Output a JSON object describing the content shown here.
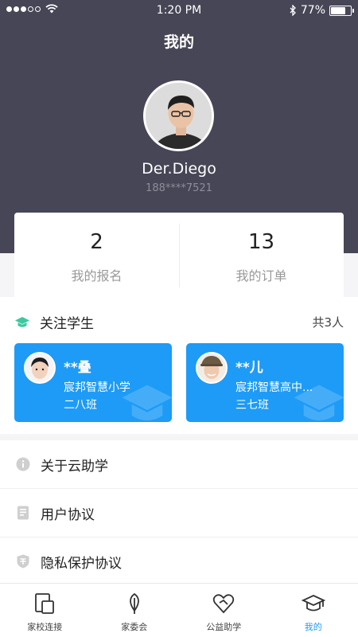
{
  "status_bar": {
    "time": "1:20 PM",
    "battery": "77%",
    "battery_level": 0.77,
    "signal_bars": 3
  },
  "header": {
    "title": "我的"
  },
  "profile": {
    "name": "Der.Diego",
    "phone": "188****7521"
  },
  "stats": [
    {
      "value": "2",
      "label": "我的报名"
    },
    {
      "value": "13",
      "label": "我的订单"
    }
  ],
  "students_section": {
    "title": "关注学生",
    "count": "共3人",
    "cards": [
      {
        "name": "**叠",
        "school": "宸邦智慧小学",
        "class": "二八班"
      },
      {
        "name": "**儿",
        "school": "宸邦智慧高中...",
        "class": "三七班"
      }
    ]
  },
  "menu": [
    {
      "label": "关于云助学",
      "icon": "info-icon"
    },
    {
      "label": "用户协议",
      "icon": "document-icon"
    },
    {
      "label": "隐私保护协议",
      "icon": "shield-icon"
    }
  ],
  "tabs": [
    {
      "label": "家校连接",
      "icon": "device-icon"
    },
    {
      "label": "家委会",
      "icon": "leaf-icon"
    },
    {
      "label": "公益助学",
      "icon": "heart-icon"
    },
    {
      "label": "我的",
      "icon": "graduation-cap-icon",
      "active": true
    }
  ],
  "colors": {
    "header_bg": "#474656",
    "accent": "#1d9bf7"
  }
}
